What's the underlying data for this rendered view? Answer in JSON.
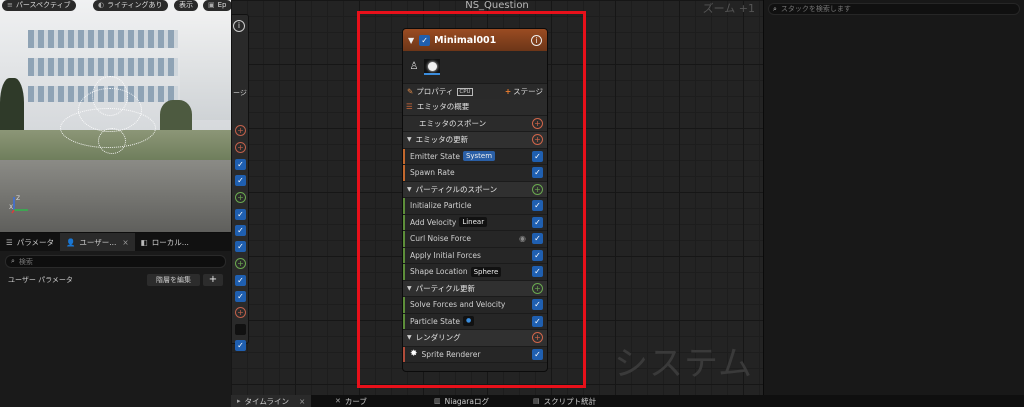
{
  "viewport": {
    "toolbar": [
      {
        "label": "パースペクティブ",
        "icon": "menu-icon"
      },
      {
        "label": "ライティングあり",
        "icon": "lighting-icon"
      },
      {
        "label": "表示",
        "icon": ""
      },
      {
        "label": "Ep",
        "icon": "camera-icon"
      }
    ],
    "axis": {
      "x": "X",
      "z": "Z"
    }
  },
  "left_panel": {
    "tabs": [
      {
        "label": "パラメータ",
        "icon": "parameters-icon"
      },
      {
        "label": "ユーザー...",
        "icon": "user-icon"
      },
      {
        "label": "ローカル...",
        "icon": "local-icon"
      }
    ],
    "search_placeholder": "検索",
    "params_label": "ユーザー パラメータ",
    "edit_hierarchy": "階層を編集",
    "add": "+"
  },
  "graph": {
    "title": "NS_Question",
    "zoom": "ズーム +1",
    "watermark": "システム",
    "system_node": {
      "stage_label": "ージ",
      "info": "i"
    }
  },
  "emitter": {
    "name": "Minimal001",
    "enabled": true,
    "toolbar": {
      "properties": "プロパティ",
      "cpu": "CPU",
      "stage": "ステージ"
    },
    "rows": [
      {
        "kind": "summary",
        "label": "エミッタの概要"
      },
      {
        "kind": "sub",
        "label": "エミッタのスポーン",
        "add": "r"
      },
      {
        "kind": "hdr",
        "label": "エミッタの更新",
        "add": "r"
      },
      {
        "kind": "mod",
        "stripe": "o",
        "label": "Emitter State",
        "pill": "System",
        "pill_style": "sel",
        "checked": true
      },
      {
        "kind": "mod",
        "stripe": "o",
        "label": "Spawn Rate",
        "checked": true
      },
      {
        "kind": "hdr",
        "label": "パーティクルのスポーン",
        "add": "g"
      },
      {
        "kind": "mod",
        "stripe": "g",
        "label": "Initialize Particle",
        "checked": true
      },
      {
        "kind": "mod",
        "stripe": "g",
        "label": "Add Velocity",
        "pill": "Linear",
        "checked": true
      },
      {
        "kind": "mod",
        "stripe": "g",
        "label": "Curl Noise Force",
        "eye": true,
        "checked": true
      },
      {
        "kind": "mod",
        "stripe": "g",
        "label": "Apply Initial Forces",
        "checked": true
      },
      {
        "kind": "mod",
        "stripe": "g",
        "label": "Shape Location",
        "pill": "Sphere",
        "checked": true
      },
      {
        "kind": "hdr",
        "label": "パーティクル更新",
        "add": "g"
      },
      {
        "kind": "mod",
        "stripe": "g",
        "label": "Solve Forces and Velocity",
        "checked": true
      },
      {
        "kind": "mod",
        "stripe": "g",
        "label": "Particle State",
        "pill": "●",
        "pill_style": "dot",
        "checked": true
      },
      {
        "kind": "hdr",
        "label": "レンダリング",
        "add": "r"
      },
      {
        "kind": "mod",
        "stripe": "r",
        "label": "Sprite Renderer",
        "sprite": true,
        "checked": true
      }
    ]
  },
  "bottom_tabs": [
    {
      "label": "タイムライン",
      "icon": "timeline-icon",
      "active": true,
      "closable": true
    },
    {
      "label": "カーブ",
      "icon": "curve-icon"
    },
    {
      "label": "Niagaraログ",
      "icon": "log-icon"
    },
    {
      "label": "スクリプト統計",
      "icon": "stats-icon"
    }
  ],
  "right_panel": {
    "search_placeholder": "スタックを検索します"
  },
  "colors": {
    "highlight": "#e8101a",
    "emitter_header": "#9a4c22",
    "check": "#1f5fb0"
  }
}
